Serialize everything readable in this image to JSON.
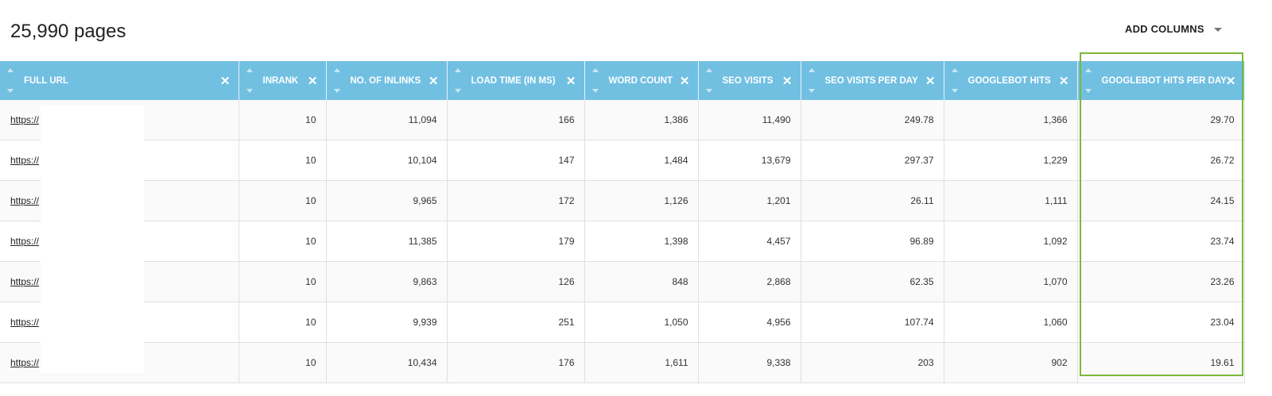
{
  "title": "25,990 pages",
  "add_columns": "ADD COLUMNS",
  "colors": {
    "header": "#71c0e2",
    "highlight": "#7cb83a"
  },
  "columns": [
    "FULL URL",
    "INRANK",
    "NO. OF INLINKS",
    "LOAD TIME (IN MS)",
    "WORD COUNT",
    "SEO VISITS",
    "SEO VISITS PER DAY",
    "GOOGLEBOT HITS",
    "GOOGLEBOT HITS PER DAY"
  ],
  "rows": [
    [
      "https://",
      "10",
      "11,094",
      "166",
      "1,386",
      "11,490",
      "249.78",
      "1,366",
      "29.70"
    ],
    [
      "https://",
      "10",
      "10,104",
      "147",
      "1,484",
      "13,679",
      "297.37",
      "1,229",
      "26.72"
    ],
    [
      "https://",
      "10",
      "9,965",
      "172",
      "1,126",
      "1,201",
      "26.11",
      "1,111",
      "24.15"
    ],
    [
      "https://",
      "10",
      "11,385",
      "179",
      "1,398",
      "4,457",
      "96.89",
      "1,092",
      "23.74"
    ],
    [
      "https://",
      "10",
      "9,863",
      "126",
      "848",
      "2,868",
      "62.35",
      "1,070",
      "23.26"
    ],
    [
      "https://",
      "10",
      "9,939",
      "251",
      "1,050",
      "4,956",
      "107.74",
      "1,060",
      "23.04"
    ],
    [
      "https://",
      "10",
      "10,434",
      "176",
      "1,611",
      "9,338",
      "203",
      "902",
      "19.61"
    ]
  ]
}
